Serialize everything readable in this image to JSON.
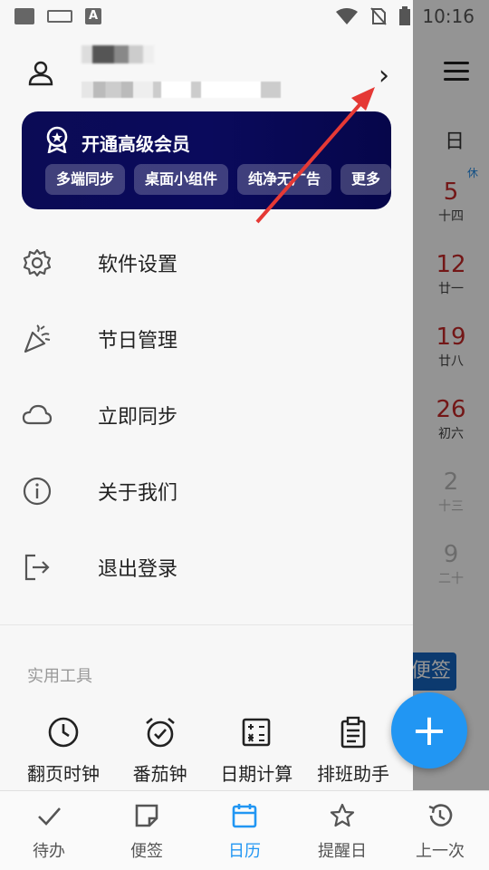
{
  "status_bar": {
    "time": "10:16"
  },
  "user": {
    "name_redacted": "",
    "id_redacted": ""
  },
  "vip": {
    "title": "开通高级会员",
    "tags": [
      "多端同步",
      "桌面小组件",
      "纯净无广告",
      "更多"
    ]
  },
  "menu": [
    {
      "label": "软件设置",
      "icon": "gear-icon"
    },
    {
      "label": "节日管理",
      "icon": "party-popper-icon"
    },
    {
      "label": "立即同步",
      "icon": "cloud-icon"
    },
    {
      "label": "关于我们",
      "icon": "info-icon"
    },
    {
      "label": "退出登录",
      "icon": "logout-icon"
    }
  ],
  "tools": {
    "title": "实用工具",
    "items": [
      {
        "label": "翻页时钟",
        "icon": "clock-icon"
      },
      {
        "label": "番茄钟",
        "icon": "alarm-clock-icon"
      },
      {
        "label": "日期计算",
        "icon": "calculator-icon"
      },
      {
        "label": "排班助手",
        "icon": "clipboard-icon"
      }
    ]
  },
  "background_calendar": {
    "weekday": "日",
    "rest_badge": "休",
    "days": [
      {
        "day": "5",
        "lunar": "十四"
      },
      {
        "day": "12",
        "lunar": "廿一"
      },
      {
        "day": "19",
        "lunar": "廿八"
      },
      {
        "day": "26",
        "lunar": "初六"
      },
      {
        "day": "2",
        "lunar": "十三"
      },
      {
        "day": "9",
        "lunar": "二十"
      }
    ],
    "note_button": "便签"
  },
  "bottom_nav": [
    {
      "label": "待办",
      "icon": "check-icon",
      "active": false
    },
    {
      "label": "便签",
      "icon": "note-icon",
      "active": false
    },
    {
      "label": "日历",
      "icon": "calendar-icon",
      "active": true
    },
    {
      "label": "提醒日",
      "icon": "star-icon",
      "active": false
    },
    {
      "label": "上一次",
      "icon": "history-icon",
      "active": false
    }
  ],
  "colors": {
    "accent": "#2196f3",
    "vip_bg": "#0a0a5c",
    "holiday_red": "#c62828",
    "arrow": "#e53935"
  }
}
